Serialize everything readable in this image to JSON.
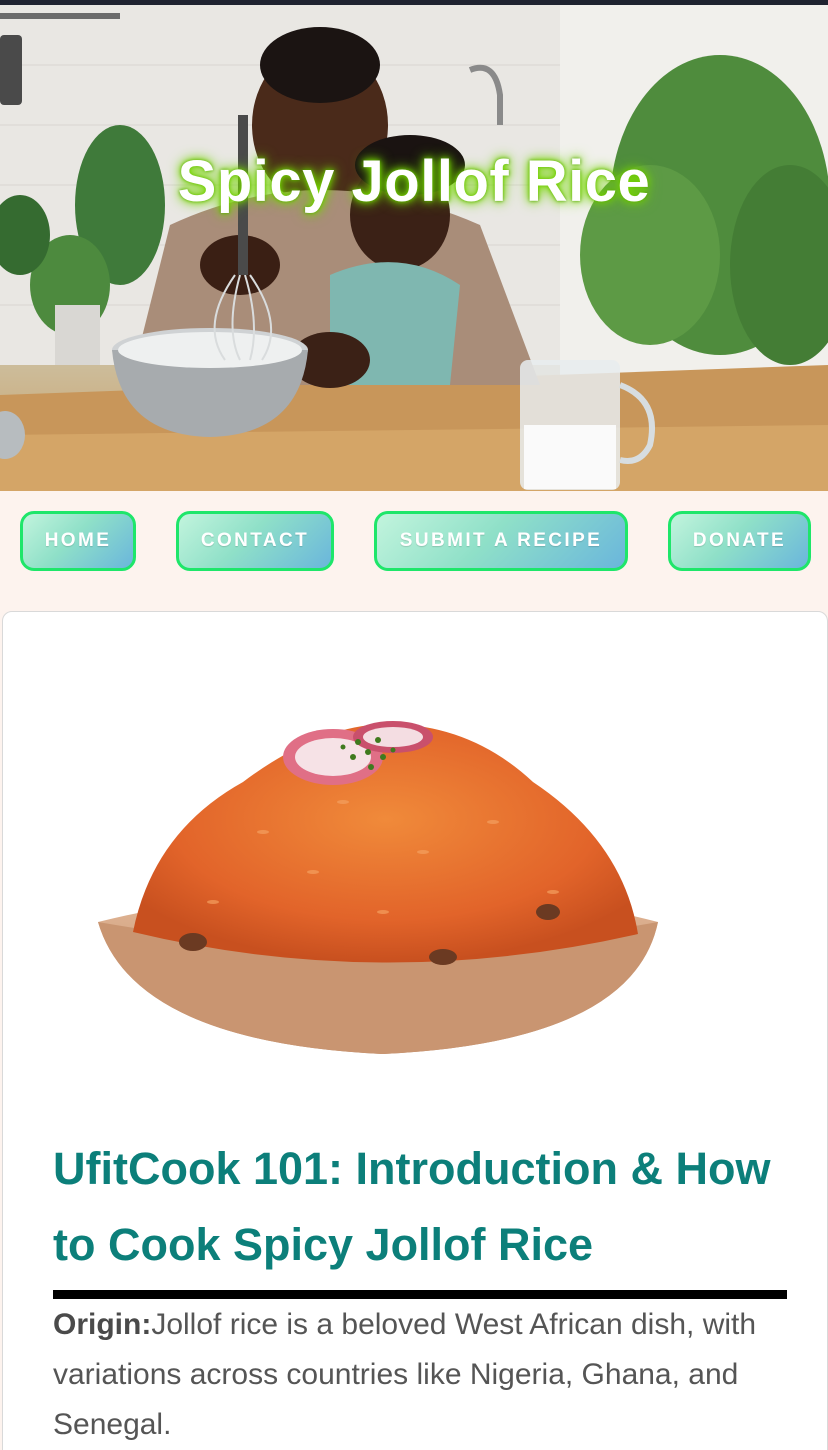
{
  "hero": {
    "title": "Spicy Jollof Rice",
    "photo": "mother-and-child-cooking-in-kitchen"
  },
  "nav": {
    "items": [
      {
        "label": "HOME"
      },
      {
        "label": "CONTACT"
      },
      {
        "label": "SUBMIT A RECIPE"
      },
      {
        "label": "DONATE"
      }
    ]
  },
  "article": {
    "image": "jollof-rice-bowl",
    "title": "UfitCook 101: Introduction & How to Cook Spicy Jollof Rice",
    "origin_label": "Origin:",
    "origin_text": "Jollof rice is a beloved West African dish, with variations across countries like Nigeria, Ghana, and Senegal."
  },
  "colors": {
    "accent_teal": "#0c7f7a",
    "nav_border": "#1ee66a",
    "title_glow": "#7fe000",
    "page_background": "#fdf3ee"
  }
}
